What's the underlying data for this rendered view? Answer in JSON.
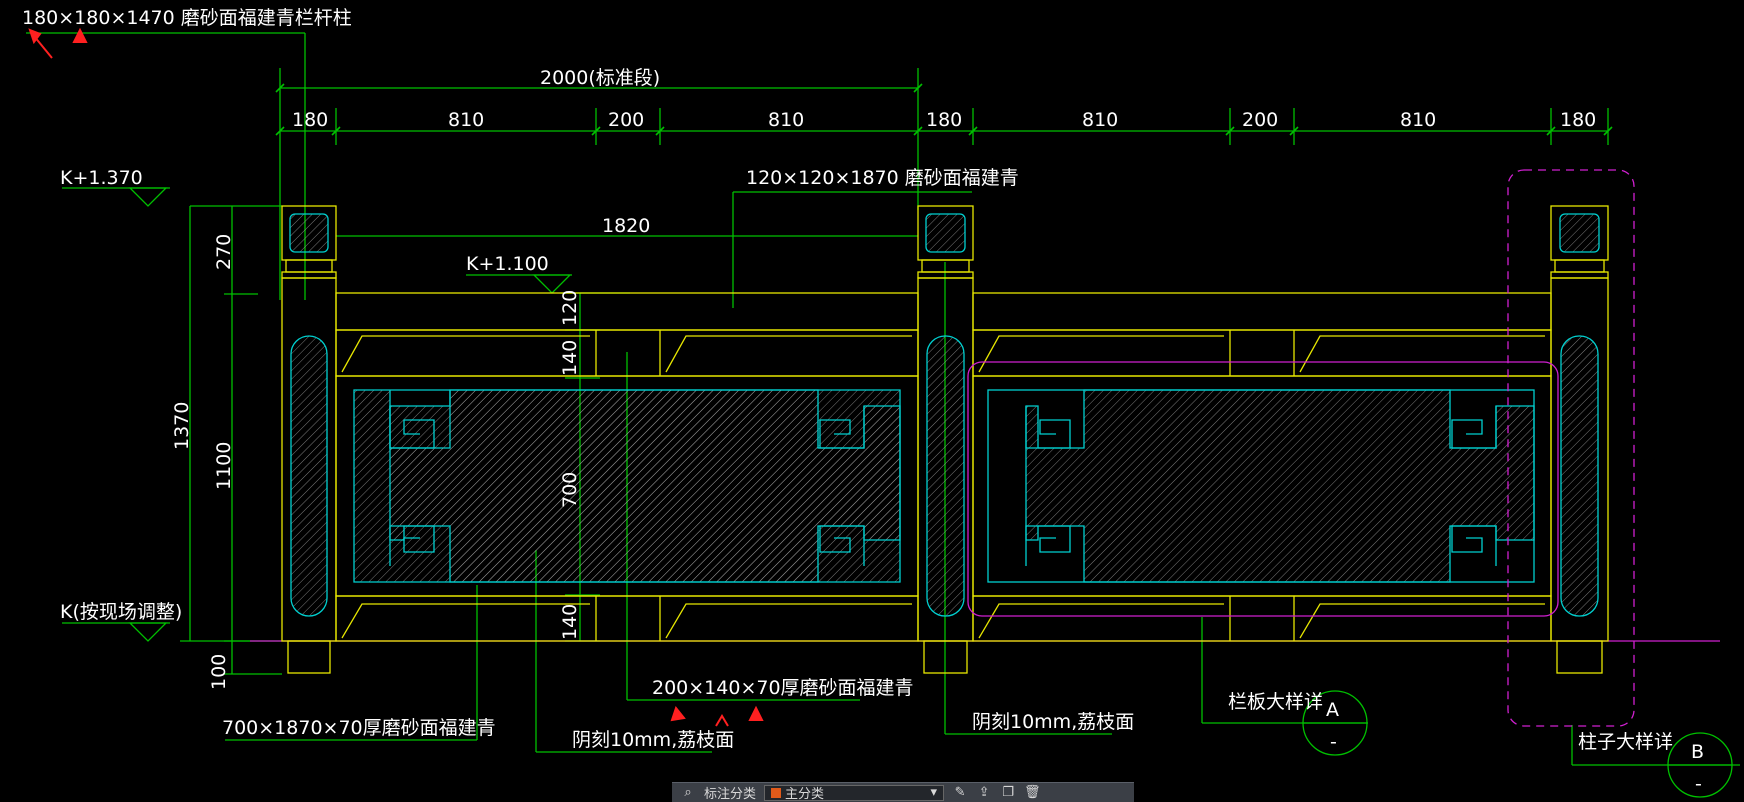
{
  "drawing": {
    "top_callout": "180×180×1470 磨砂面福建青栏杆柱",
    "dim_overall": "2000(标准段)",
    "dim_segments": [
      "180",
      "810",
      "200",
      "810",
      "180",
      "810",
      "200",
      "810",
      "180"
    ],
    "dim_rail_span": "1820",
    "beam_callout": "120×120×1870 磨砂面福建青",
    "level_top": "K+1.370",
    "level_mid": "K+1.100",
    "level_base": "K(按现场调整)",
    "vertical_dims": {
      "post_cap": "270",
      "total": "1370",
      "rail_height": "1100",
      "base": "100",
      "top_rail": "120",
      "upper_band": "140",
      "panel": "700",
      "lower_band": "140"
    },
    "callout_panel_slab": "700×1870×70厚磨砂面福建青",
    "callout_band": "200×140×70厚磨砂面福建青",
    "callout_carve_1": "阴刻10mm,荔枝面",
    "callout_carve_2": "阴刻10mm,荔枝面",
    "detail_a_label": "栏板大样详",
    "detail_a_id": "A",
    "detail_a_sub": "-",
    "detail_b_label": "柱子大样详",
    "detail_b_id": "B",
    "detail_b_sub": "-"
  },
  "toolbar": {
    "label": "标注分类",
    "layer": "主分类",
    "icons": [
      "binoculars-icon",
      "pencil-icon",
      "export-icon",
      "copy-icon",
      "trash-icon"
    ]
  },
  "colors": {
    "background": "#000000",
    "dimension": "#00c000",
    "outline": "#e6e600",
    "panel": "#00d0d0",
    "highlight": "#d020d0",
    "marker": "#ff2020"
  }
}
